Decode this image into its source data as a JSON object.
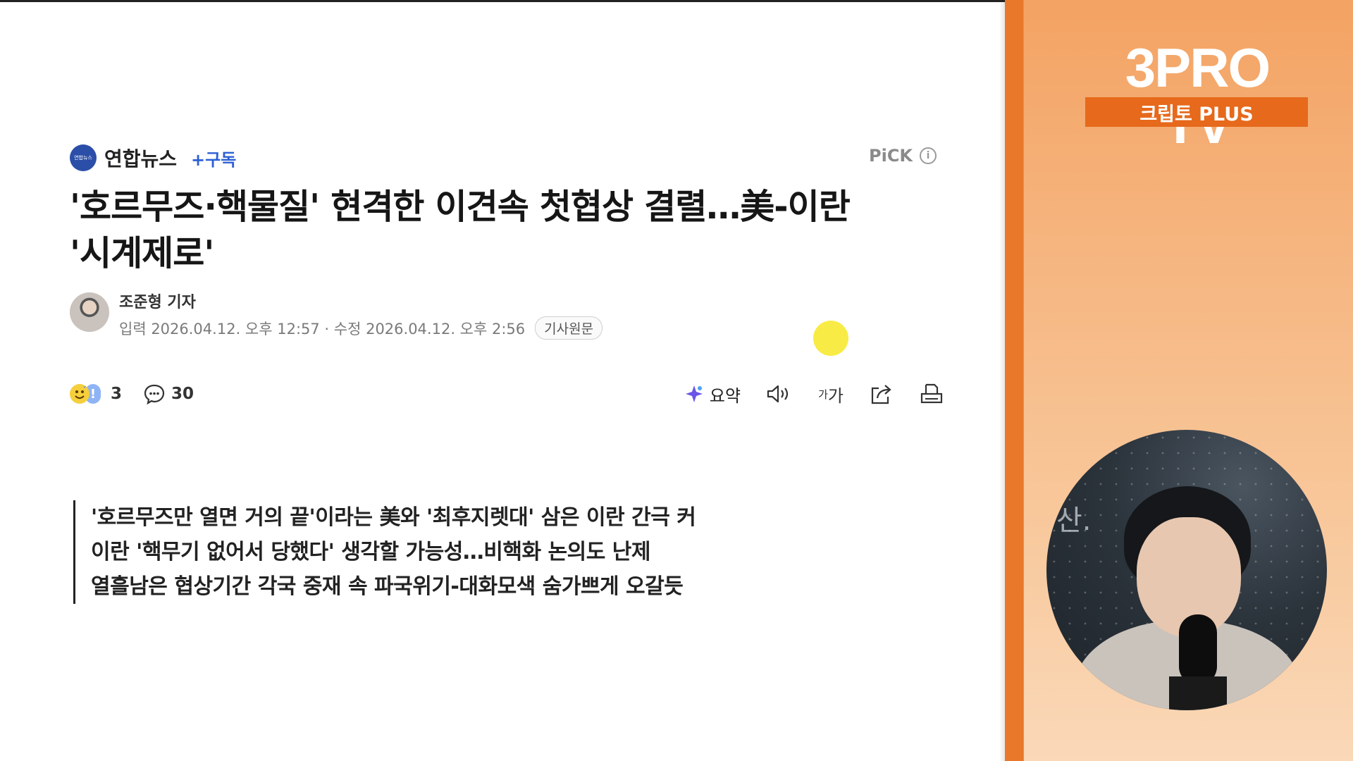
{
  "article": {
    "press": {
      "logo_text": "연합뉴스",
      "name": "연합뉴스",
      "subscribe": "+구독"
    },
    "pick_label": "PiCK",
    "headline_line1": "'호르무즈·핵물질' 현격한 이견속 첫협상 결렬…美-이란",
    "headline_line2": "'시계제로'",
    "reporter": {
      "name": "조준형 기자",
      "datetime": "입력 2026.04.12. 오후 12:57 · 수정 2026.04.12. 오후 2:56",
      "original_button": "기사원문"
    },
    "reactions": {
      "count": "3",
      "comments": "30"
    },
    "tools": {
      "summary_label": "요약",
      "fontsize_small": "가",
      "fontsize_large": "가"
    },
    "lead_lines": [
      "'호르무즈만 열면 거의 끝'이라는 美와 '최후지렛대' 삼은 이란 간극 커",
      "이란 '핵무기 없어서 당했다' 생각할 가능성…비핵화 논의도 난제",
      "열흘남은 협상기간 각국 중재 속 파국위기-대화모색 숨가쁘게 오갈듯"
    ]
  },
  "panel": {
    "brand_title": "3PRO TV",
    "brand_subtitle": "크립토 PLUS",
    "webcam_wall_char": "산."
  },
  "colors": {
    "accent_blue": "#2d5fd4",
    "panel_orange": "#e6691c",
    "cursor_highlight": "#f7e824"
  }
}
